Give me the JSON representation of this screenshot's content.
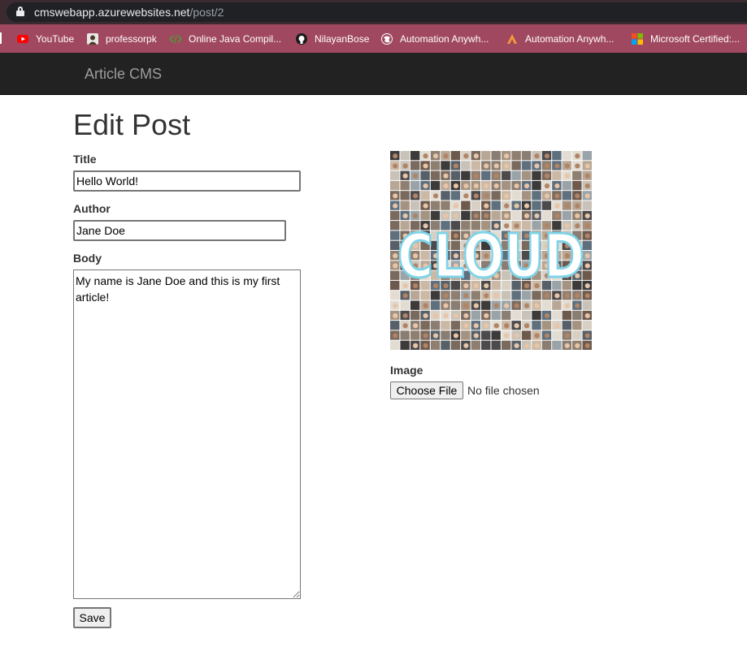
{
  "browser": {
    "url_host": "cmswebapp.azurewebsites.net",
    "url_path": "/post/2",
    "bookmarks": [
      {
        "label": "YouTube",
        "icon": "youtube-icon"
      },
      {
        "label": "professorpk",
        "icon": "avatar-icon"
      },
      {
        "label": "Online Java Compil...",
        "icon": "code-icon"
      },
      {
        "label": "NilayanBose",
        "icon": "github-icon"
      },
      {
        "label": "Automation Anywh...",
        "icon": "globe-icon"
      },
      {
        "label": "Automation Anywh...",
        "icon": "triangle-logo-icon"
      },
      {
        "label": "Microsoft Certified:...",
        "icon": "microsoft-icon"
      }
    ]
  },
  "navbar": {
    "brand": "Article CMS"
  },
  "page": {
    "title": "Edit Post",
    "title_label": "Title",
    "title_value": "Hello World!",
    "author_label": "Author",
    "author_value": "Jane Doe",
    "body_label": "Body",
    "body_value": "My name is Jane Doe and this is my first article!",
    "image_label": "Image",
    "image_alt_text": "CLOUD",
    "file_button_label": "Choose File",
    "file_status": "No file chosen",
    "save_label": "Save"
  },
  "colors": {
    "bookmark_bar": "#a0485f",
    "navbar": "#222222",
    "brand_text": "#9d9d9d"
  }
}
